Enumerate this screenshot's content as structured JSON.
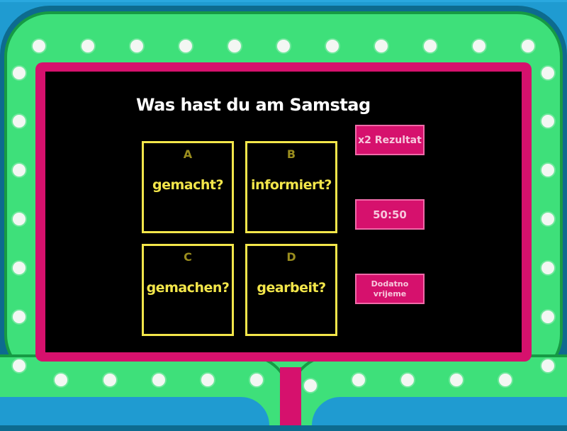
{
  "quiz": {
    "question": "Was hast du am Samstag",
    "answers": [
      {
        "letter": "A",
        "text": "gemacht?"
      },
      {
        "letter": "B",
        "text": "informiert?"
      },
      {
        "letter": "C",
        "text": "gemachen?"
      },
      {
        "letter": "D",
        "text": "gearbeit?"
      }
    ]
  },
  "powerups": {
    "double": "x2 Rezultat",
    "fifty": "50:50",
    "extra_time": "Dodatno vrijeme"
  },
  "colors": {
    "background": "#1f9bd1",
    "board_green": "#3ee07a",
    "frame_pink": "#d6116d",
    "answer_yellow": "#f3e64a",
    "screen": "#000000"
  }
}
